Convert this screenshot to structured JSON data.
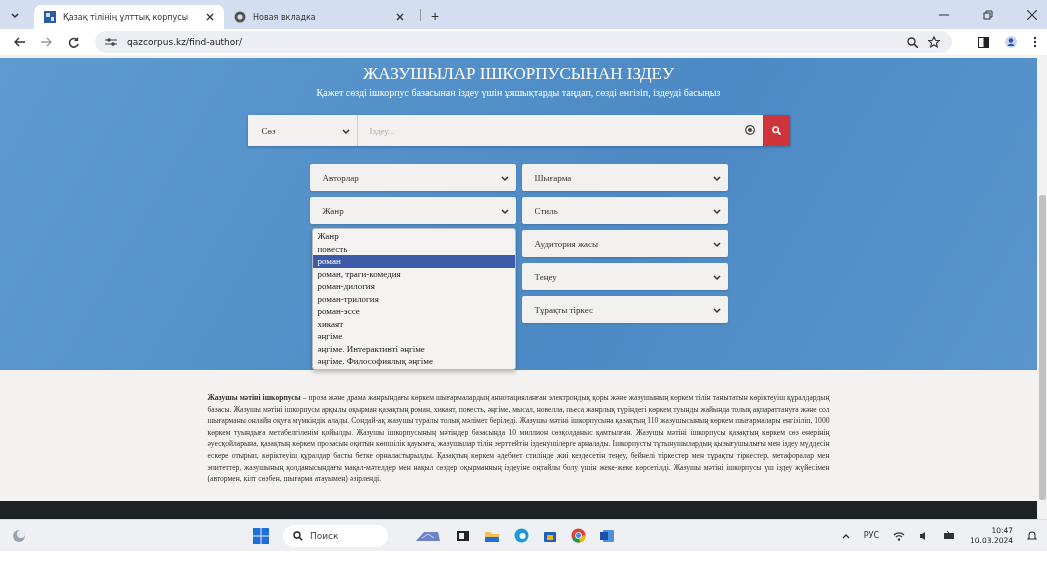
{
  "browser": {
    "tabs": [
      {
        "title": "Қазақ тілінің ұлттық корпусы",
        "selected": true
      },
      {
        "title": "Новая вкладка",
        "selected": false
      }
    ],
    "new_tab": "+",
    "address": "qazcorpus.kz/find-author/"
  },
  "page": {
    "heading": "ЖАЗУШЫЛАР ІШКОРПУСЫНАН ІЗДЕУ",
    "subheading": "Қажет сөзді ішкорпус базасынан іздеу үшін ұяшықтарды таңдап, сөзді енгізіп, іздеуді басыңыз",
    "search": {
      "mode": "Сөз",
      "placeholder": "Іздеу..."
    },
    "filters_left": [
      {
        "label": "Авторлар"
      },
      {
        "label": "Жанр",
        "open_options": [
          {
            "label": "Жанр",
            "selected": false
          },
          {
            "label": "повесть",
            "selected": false
          },
          {
            "label": "роман",
            "selected": true
          },
          {
            "label": "роман, траги-комедия",
            "selected": false
          },
          {
            "label": "роман-дилогия",
            "selected": false
          },
          {
            "label": "роман-трилогия",
            "selected": false
          },
          {
            "label": "роман-эссе",
            "selected": false
          },
          {
            "label": "хикаят",
            "selected": false
          },
          {
            "label": "әңгіме",
            "selected": false
          },
          {
            "label": "әңгіме. Интерактивті әңгіме",
            "selected": false
          },
          {
            "label": "әңгіме. Философиялық әңгіме",
            "selected": false
          }
        ]
      }
    ],
    "filters_right": [
      {
        "label": "Шығарма"
      },
      {
        "label": "Стиль"
      },
      {
        "label": "Аудитория жасы"
      },
      {
        "label": "Теңеу"
      },
      {
        "label": "Тұрақты тіркес"
      }
    ],
    "description": "**Жазушы мәтіні ішкорпусы** – проза және драма жанрындағы көркем шығармалардың аннотацияланған электрондық қоры және жазушының көркем тілін танытатын көріктеуіш құралдардың базасы. Жазушы мәтіні ішкорпусы арқылы оқырман қазақтың роман, хикаят, повесть, әңгіме, мысал, новелла, пьеса жанрлық түріндегі көркем туынды жайында толық ақпараттануға және сол шығарманы онлайн оқуға мүмкіндік алады. Сондай-ақ жазушы туралы толық мәлімет беріледі. Жазушы мәтіні ішкорпусына қазақтың 110 жазушысының көркем шығармалары енгізіліп, 1000 көркем туындыға метабелгіленім қойылды. Жазушы ішкорпусының мәтіндер базасында 10 миллион сөзқолданыс қамтылған. Жазушы мәтіні ішкорпусы қазақтың көркем сөз өнерінің әуесқойларына, қазақтың көркем прозасын оқитын көпшілік қауымға, жазушылар тілін зерттейтін ізденушілерге арналады. Ішкорпусты тұтынушылардың қызығушылығы мен іздеу мүддесін ескере отырып, көріктеуіш құралдар басты бетке орналастырылды. Қазақтың көркем әдебиет стилінде жиі кездесетін теңеу, бейнелі тіркестер мен тұрақты тіркестер, метафоралар мен эпитеттер, жазушының қолданысындағы мақал-мәтелдер мен нақыл сөздер оқырманның іздеуіне оңтайлы болу үшін жеке-жеке көрсетілді. Жазушы мәтіні ішкорпусы үш іздеу жүйесімен (автормен, кілт сөзбен, шығарма атауымен) әзірленді."
  },
  "taskbar": {
    "search_placeholder": "Поиск",
    "language": "РУС",
    "time": "10:47",
    "date": "10.03.2024"
  }
}
